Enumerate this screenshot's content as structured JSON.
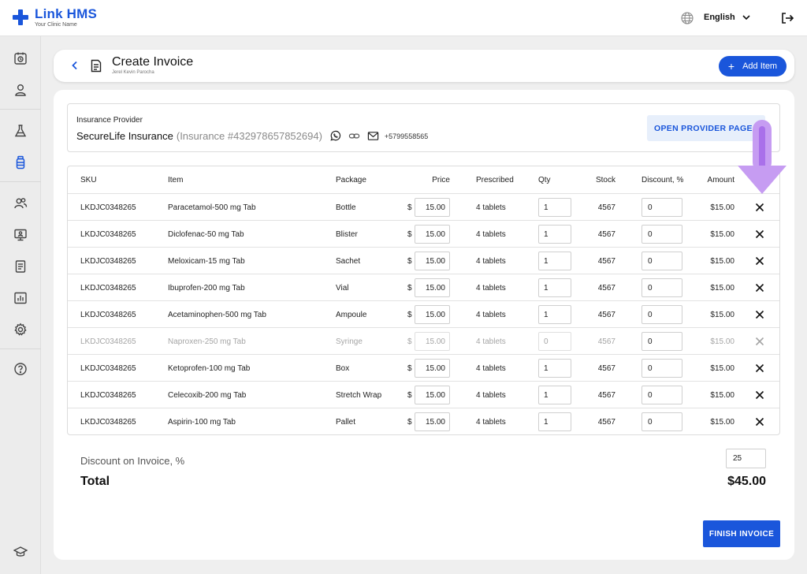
{
  "app": {
    "name": "Link HMS",
    "subtitle": "Your Clinic Name"
  },
  "topbar": {
    "language": "English",
    "icons": [
      "globe-icon",
      "chevron-down-icon",
      "logout-icon"
    ]
  },
  "sidebar": {
    "items": [
      "appointments-icon",
      "patients-icon",
      "lab-icon",
      "pharmacy-icon",
      "staff-icon",
      "monitor-icon",
      "reports-icon",
      "analytics-icon",
      "settings-icon",
      "help-icon",
      "education-icon"
    ],
    "active": "pharmacy-icon"
  },
  "header": {
    "title": "Create Invoice",
    "subtitle": "Jerel Kevin Parocha",
    "add_button": "Add Item"
  },
  "insurance": {
    "label": "Insurance Provider",
    "name": "SecureLife Insurance",
    "number": "(Insurance #432978657852694)",
    "phone": "+5799558565",
    "open_button": "OPEN PROVIDER PAGE"
  },
  "table": {
    "headers": {
      "sku": "SKU",
      "item": "Item",
      "package": "Package",
      "price": "Price",
      "prescribed": "Prescribed",
      "qty": "Qty",
      "stock": "Stock",
      "discount": "Discount, %",
      "amount": "Amount"
    },
    "currency": "$",
    "rows": [
      {
        "sku": "LKDJC0348265",
        "item": "Paracetamol-500 mg Tab",
        "package": "Bottle",
        "price": "15.00",
        "prescribed": "4 tablets",
        "qty": "1",
        "stock": "4567",
        "discount": "0",
        "amount": "$15.00"
      },
      {
        "sku": "LKDJC0348265",
        "item": "Diclofenac-50 mg Tab",
        "package": "Blister",
        "price": "15.00",
        "prescribed": "4 tablets",
        "qty": "1",
        "stock": "4567",
        "discount": "0",
        "amount": "$15.00"
      },
      {
        "sku": "LKDJC0348265",
        "item": "Meloxicam-15 mg Tab",
        "package": "Sachet",
        "price": "15.00",
        "prescribed": "4 tablets",
        "qty": "1",
        "stock": "4567",
        "discount": "0",
        "amount": "$15.00"
      },
      {
        "sku": "LKDJC0348265",
        "item": "Ibuprofen-200 mg Tab",
        "package": "Vial",
        "price": "15.00",
        "prescribed": "4 tablets",
        "qty": "1",
        "stock": "4567",
        "discount": "0",
        "amount": "$15.00"
      },
      {
        "sku": "LKDJC0348265",
        "item": "Acetaminophen-500 mg Tab",
        "package": "Ampoule",
        "price": "15.00",
        "prescribed": "4 tablets",
        "qty": "1",
        "stock": "4567",
        "discount": "0",
        "amount": "$15.00"
      },
      {
        "sku": "LKDJC0348265",
        "item": "Naproxen-250 mg Tab",
        "package": "Syringe",
        "price": "15.00",
        "prescribed": "4 tablets",
        "qty": "0",
        "stock": "4567",
        "discount": "0",
        "amount": "$15.00"
      },
      {
        "sku": "LKDJC0348265",
        "item": "Ketoprofen-100 mg Tab",
        "package": "Box",
        "price": "15.00",
        "prescribed": "4 tablets",
        "qty": "1",
        "stock": "4567",
        "discount": "0",
        "amount": "$15.00"
      },
      {
        "sku": "LKDJC0348265",
        "item": "Celecoxib-200 mg Tab",
        "package": "Stretch Wrap",
        "price": "15.00",
        "prescribed": "4 tablets",
        "qty": "1",
        "stock": "4567",
        "discount": "0",
        "amount": "$15.00"
      },
      {
        "sku": "LKDJC0348265",
        "item": "Aspirin-100 mg Tab",
        "package": "Pallet",
        "price": "15.00",
        "prescribed": "4 tablets",
        "qty": "1",
        "stock": "4567",
        "discount": "0",
        "amount": "$15.00"
      }
    ],
    "disabled_row": 5
  },
  "summary": {
    "discount_label": "Discount on Invoice, %",
    "discount_value": "25",
    "total_label": "Total",
    "total_value": "$45.00",
    "finish_button": "FINISH INVOICE"
  },
  "colors": {
    "accent": "#1a56db",
    "arrow": "#c69cf2",
    "open_button_bg": "#e7effb"
  }
}
